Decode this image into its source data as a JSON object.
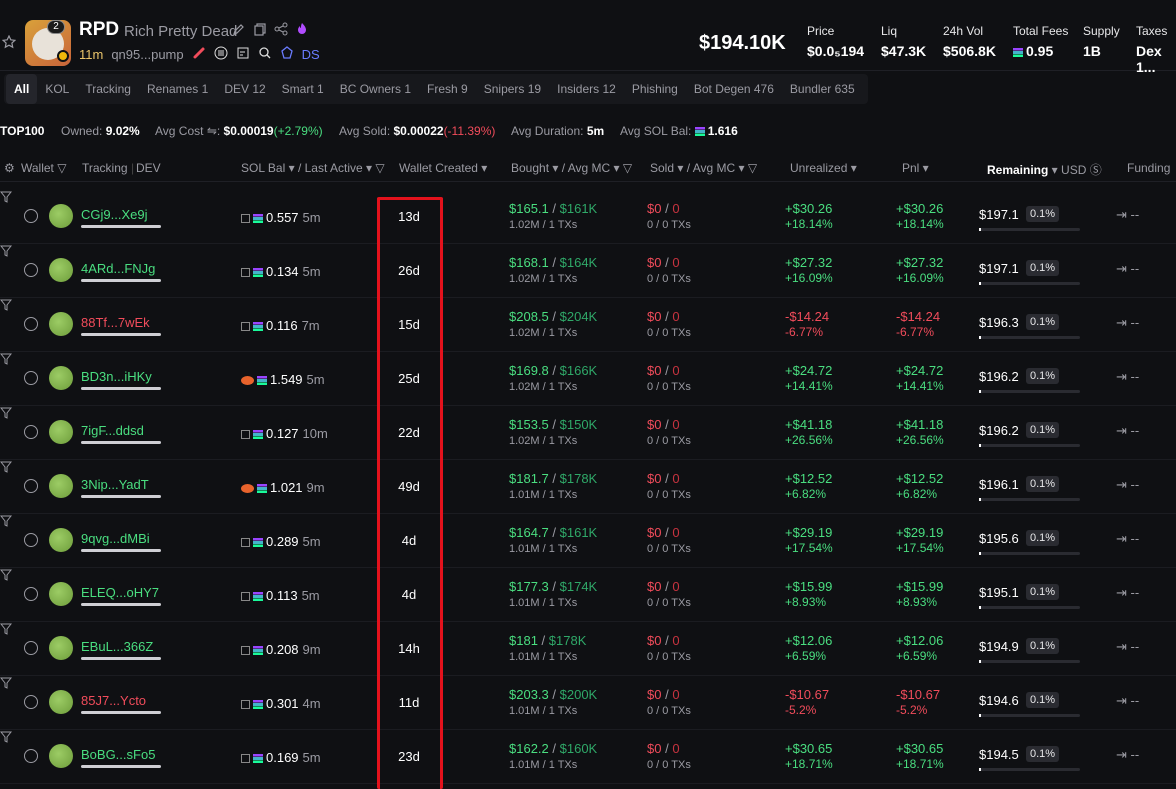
{
  "token": {
    "ticker": "RPD",
    "name": "Rich Pretty Dead",
    "badge_count": "2",
    "age": "11m",
    "address": "qn95...pump",
    "ds_label": "DS",
    "market_cap": "$194.10K"
  },
  "stats": [
    {
      "label": "Price",
      "value": "$0.0₅194"
    },
    {
      "label": "Liq",
      "value": "$47.3K"
    },
    {
      "label": "24h Vol",
      "value": "$506.8K"
    },
    {
      "label": "Total Fees",
      "value": "0.95"
    },
    {
      "label": "Supply",
      "value": "1B"
    },
    {
      "label": "Taxes",
      "value": "Dex 1..."
    }
  ],
  "tabs": [
    "All",
    "KOL",
    "Tracking",
    "Renames 1",
    "DEV 12",
    "Smart 1",
    "BC Owners 1",
    "Fresh 9",
    "Snipers 19",
    "Insiders 12",
    "Phishing",
    "Bot Degen 476",
    "Bundler 635"
  ],
  "summary": {
    "top": "TOP100",
    "owned_label": "Owned:",
    "owned": "9.02%",
    "avg_cost_label": "Avg Cost",
    "avg_cost": "$0.00019",
    "avg_cost_change": "(+2.79%)",
    "avg_sold_label": "Avg Sold:",
    "avg_sold": "$0.00022",
    "avg_sold_change": "(-11.39%)",
    "avg_duration_label": "Avg Duration:",
    "avg_duration": "5m",
    "avg_sol_label": "Avg SOL Bal:",
    "avg_sol": "1.616"
  },
  "columns": {
    "wallet": "Wallet",
    "tracking": "Tracking",
    "dev": "DEV",
    "sol_bal": "SOL Bal",
    "last_active": "/ Last Active",
    "wallet_created": "Wallet Created",
    "bought": "Bought",
    "avg_mc": "/ Avg MC",
    "sold": "Sold",
    "sold_avg_mc": "/ Avg MC",
    "unrealized": "Unrealized",
    "pnl": "Pnl",
    "remaining": "Remaining",
    "usd": "USD",
    "funding": "Funding"
  },
  "rows": [
    {
      "wallet": "CGj9...Xe9j",
      "wallet_color": "#4ade80",
      "sol": "0.557",
      "last": "5m",
      "created": "13d",
      "bought": "$165.1",
      "bought_mc": "$161K",
      "bought_sub": "1.02M / 1 TXs",
      "sold": "$0",
      "sold_mc": "0",
      "sold_sub": "0 / 0 TXs",
      "unr": "+$30.26",
      "unr_pct": "+18.14%",
      "pnl": "+$30.26",
      "pnl_pct": "+18.14%",
      "pos": true,
      "rem": "$197.1",
      "pct": "0.1%",
      "funding": "--"
    },
    {
      "wallet": "4ARd...FNJg",
      "wallet_color": "#4ade80",
      "sol": "0.134",
      "last": "5m",
      "created": "26d",
      "bought": "$168.1",
      "bought_mc": "$164K",
      "bought_sub": "1.02M / 1 TXs",
      "sold": "$0",
      "sold_mc": "0",
      "sold_sub": "0 / 0 TXs",
      "unr": "+$27.32",
      "unr_pct": "+16.09%",
      "pnl": "+$27.32",
      "pnl_pct": "+16.09%",
      "pos": true,
      "rem": "$197.1",
      "pct": "0.1%",
      "funding": "--"
    },
    {
      "wallet": "88Tf...7wEk",
      "wallet_color": "#f14c5b",
      "sol": "0.116",
      "last": "7m",
      "created": "15d",
      "bought": "$208.5",
      "bought_mc": "$204K",
      "bought_sub": "1.02M / 1 TXs",
      "sold": "$0",
      "sold_mc": "0",
      "sold_sub": "0 / 0 TXs",
      "unr": "-$14.24",
      "unr_pct": "-6.77%",
      "pnl": "-$14.24",
      "pnl_pct": "-6.77%",
      "pos": false,
      "rem": "$196.3",
      "pct": "0.1%",
      "funding": "--"
    },
    {
      "wallet": "BD3n...iHKy",
      "wallet_color": "#4ade80",
      "sol": "1.549",
      "last": "5m",
      "created": "25d",
      "bought": "$169.8",
      "bought_mc": "$166K",
      "bought_sub": "1.02M / 1 TXs",
      "sold": "$0",
      "sold_mc": "0",
      "sold_sub": "0 / 0 TXs",
      "unr": "+$24.72",
      "unr_pct": "+14.41%",
      "pnl": "+$24.72",
      "pnl_pct": "+14.41%",
      "pos": true,
      "rem": "$196.2",
      "pct": "0.1%",
      "funding": "--"
    },
    {
      "wallet": "7igF...ddsd",
      "wallet_color": "#4ade80",
      "sol": "0.127",
      "last": "10m",
      "created": "22d",
      "bought": "$153.5",
      "bought_mc": "$150K",
      "bought_sub": "1.02M / 1 TXs",
      "sold": "$0",
      "sold_mc": "0",
      "sold_sub": "0 / 0 TXs",
      "unr": "+$41.18",
      "unr_pct": "+26.56%",
      "pnl": "+$41.18",
      "pnl_pct": "+26.56%",
      "pos": true,
      "rem": "$196.2",
      "pct": "0.1%",
      "funding": "--"
    },
    {
      "wallet": "3Nip...YadT",
      "wallet_color": "#4ade80",
      "sol": "1.021",
      "last": "9m",
      "created": "49d",
      "bought": "$181.7",
      "bought_mc": "$178K",
      "bought_sub": "1.01M / 1 TXs",
      "sold": "$0",
      "sold_mc": "0",
      "sold_sub": "0 / 0 TXs",
      "unr": "+$12.52",
      "unr_pct": "+6.82%",
      "pnl": "+$12.52",
      "pnl_pct": "+6.82%",
      "pos": true,
      "rem": "$196.1",
      "pct": "0.1%",
      "funding": "--"
    },
    {
      "wallet": "9qvg...dMBi",
      "wallet_color": "#4ade80",
      "sol": "0.289",
      "last": "5m",
      "created": "4d",
      "bought": "$164.7",
      "bought_mc": "$161K",
      "bought_sub": "1.01M / 1 TXs",
      "sold": "$0",
      "sold_mc": "0",
      "sold_sub": "0 / 0 TXs",
      "unr": "+$29.19",
      "unr_pct": "+17.54%",
      "pnl": "+$29.19",
      "pnl_pct": "+17.54%",
      "pos": true,
      "rem": "$195.6",
      "pct": "0.1%",
      "funding": "--"
    },
    {
      "wallet": "ELEQ...oHY7",
      "wallet_color": "#4ade80",
      "sol": "0.113",
      "last": "5m",
      "created": "4d",
      "bought": "$177.3",
      "bought_mc": "$174K",
      "bought_sub": "1.01M / 1 TXs",
      "sold": "$0",
      "sold_mc": "0",
      "sold_sub": "0 / 0 TXs",
      "unr": "+$15.99",
      "unr_pct": "+8.93%",
      "pnl": "+$15.99",
      "pnl_pct": "+8.93%",
      "pos": true,
      "rem": "$195.1",
      "pct": "0.1%",
      "funding": "--"
    },
    {
      "wallet": "EBuL...366Z",
      "wallet_color": "#4ade80",
      "sol": "0.208",
      "last": "9m",
      "created": "14h",
      "bought": "$181",
      "bought_mc": "$178K",
      "bought_sub": "1.01M / 1 TXs",
      "sold": "$0",
      "sold_mc": "0",
      "sold_sub": "0 / 0 TXs",
      "unr": "+$12.06",
      "unr_pct": "+6.59%",
      "pnl": "+$12.06",
      "pnl_pct": "+6.59%",
      "pos": true,
      "rem": "$194.9",
      "pct": "0.1%",
      "funding": "--"
    },
    {
      "wallet": "85J7...Ycto",
      "wallet_color": "#f14c5b",
      "sol": "0.301",
      "last": "4m",
      "created": "11d",
      "bought": "$203.3",
      "bought_mc": "$200K",
      "bought_sub": "1.01M / 1 TXs",
      "sold": "$0",
      "sold_mc": "0",
      "sold_sub": "0 / 0 TXs",
      "unr": "-$10.67",
      "unr_pct": "-5.2%",
      "pnl": "-$10.67",
      "pnl_pct": "-5.2%",
      "pos": false,
      "rem": "$194.6",
      "pct": "0.1%",
      "funding": "--"
    },
    {
      "wallet": "BoBG...sFo5",
      "wallet_color": "#4ade80",
      "sol": "0.169",
      "last": "5m",
      "created": "23d",
      "bought": "$162.2",
      "bought_mc": "$160K",
      "bought_sub": "1.01M / 1 TXs",
      "sold": "$0",
      "sold_mc": "0",
      "sold_sub": "0 / 0 TXs",
      "unr": "+$30.65",
      "unr_pct": "+18.71%",
      "pnl": "+$30.65",
      "pnl_pct": "+18.71%",
      "pos": true,
      "rem": "$194.5",
      "pct": "0.1%",
      "funding": "--"
    }
  ],
  "colors": {
    "positive": "#4ade80",
    "negative": "#f14c5b",
    "highlight": "#e3121c"
  }
}
